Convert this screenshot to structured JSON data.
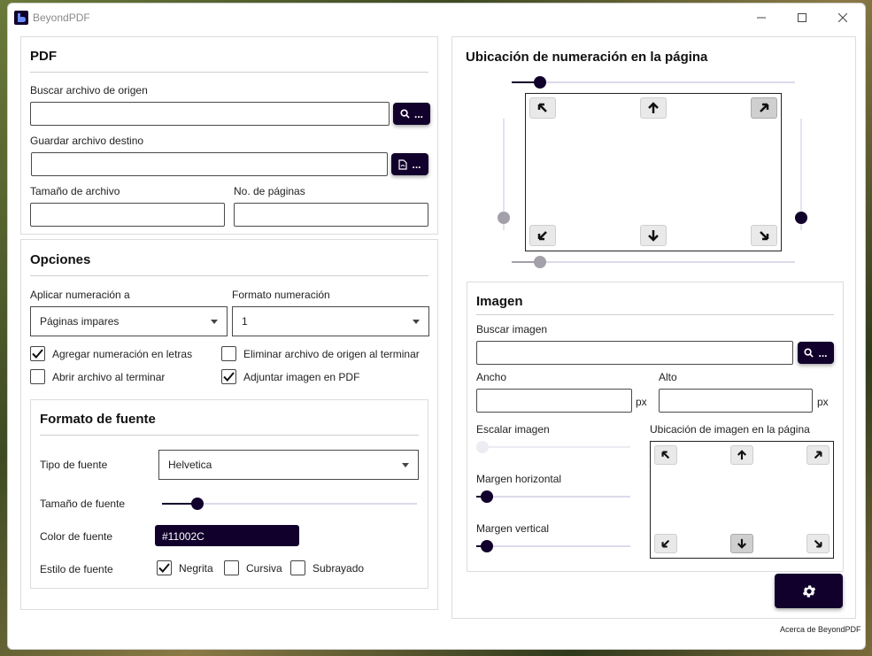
{
  "window": {
    "title": "BeyondPDF",
    "minimize": "—",
    "maximize": "☐",
    "close": "✕"
  },
  "pdf": {
    "title": "PDF",
    "source_label": "Buscar archivo de origen",
    "source_value": "",
    "dest_label": "Guardar archivo destino",
    "dest_value": "",
    "browse_suffix": "...",
    "size_label": "Tamaño de archivo",
    "size_value": "",
    "pages_label": "No. de páginas",
    "pages_value": ""
  },
  "options": {
    "title": "Opciones",
    "apply_label": "Aplicar numeración a",
    "apply_value": "Páginas impares",
    "format_label": "Formato numeración",
    "format_value": "1",
    "checkboxes": [
      {
        "label": "Agregar numeración en letras",
        "checked": true
      },
      {
        "label": "Eliminar archivo de origen al terminar",
        "checked": false
      },
      {
        "label": "Abrir archivo al terminar",
        "checked": false
      },
      {
        "label": "Adjuntar imagen en PDF",
        "checked": true
      }
    ]
  },
  "font": {
    "title": "Formato de fuente",
    "type_label": "Tipo de fuente",
    "type_value": "Helvetica",
    "size_label": "Tamaño de fuente",
    "size_level": 0.14,
    "color_label": "Color de fuente",
    "color_value": "#11002C",
    "style_label": "Estilo de fuente",
    "styles": [
      {
        "label": "Negrita",
        "checked": true
      },
      {
        "label": "Cursiva",
        "checked": false
      },
      {
        "label": "Subrayado",
        "checked": false
      }
    ]
  },
  "numbering_position": {
    "title": "Ubicación de numeración en la página",
    "horizontal_top_level": 0.1,
    "horizontal_bottom_level": 0.1,
    "vertical_left_level": 0.0,
    "vertical_right_level": 0.0,
    "selected": "top-right"
  },
  "image": {
    "title": "Imagen",
    "search_label": "Buscar imagen",
    "search_value": "",
    "width_label": "Ancho",
    "width_value": "",
    "height_label": "Alto",
    "height_value": "",
    "unit": "px",
    "scale_label": "Escalar imagen",
    "scale_level": 0.0,
    "hmargin_label": "Margen horizontal",
    "hmargin_level": 0.05,
    "vmargin_label": "Margen vertical",
    "vmargin_level": 0.05,
    "position_label": "Ubicación de imagen en la página",
    "selected": "bottom-center"
  },
  "footer": {
    "about": "Acerca de BeyondPDF"
  },
  "colors": {
    "accent": "#11002C",
    "track": "#dcdaea",
    "knob_disabled": "#a3a0aa"
  }
}
